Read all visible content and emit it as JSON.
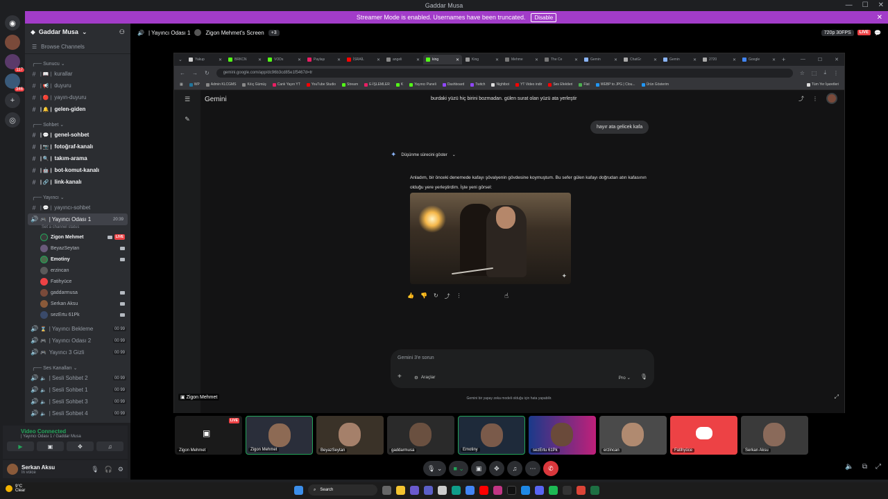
{
  "window": {
    "title": "Gaddar Musa"
  },
  "banner": {
    "text": "Streamer Mode is enabled. Usernames have been truncated.",
    "button": "Disable"
  },
  "server": {
    "name": "Gaddar Musa",
    "browse": "Browse Channels",
    "badges": [
      "117",
      "346"
    ],
    "categories": {
      "sunucu": "Sunucu",
      "sohbet": "Sohbet",
      "yayinci": "Yayıncı",
      "ses": "Ses Kanalları"
    },
    "text_channels": {
      "kurallar": "kurallar",
      "duyuru": "duyuru",
      "yayin_duyuru": "yayın-duyuru",
      "gelen_giden": "gelen-giden",
      "genel_sohbet": "genel-sohbet",
      "fotograf": "fotoğraf-kanalı",
      "takim": "takım-arama",
      "bot": "bot-komut-kanalı",
      "link": "link-kanalı",
      "yayinci_sohbet": "yayıncı-sohbet"
    },
    "voice_active": {
      "name": "| Yayıncı Odası 1",
      "time": "20:39",
      "status": "Set a channel status"
    },
    "voice_users": [
      {
        "name": "Zigon Mehmet",
        "live": "LIVE"
      },
      {
        "name": "BeyazSeytan"
      },
      {
        "name": "Emotiny"
      },
      {
        "name": "erzincan"
      },
      {
        "name": "Fatihyüce"
      },
      {
        "name": "gaddarmusa"
      },
      {
        "name": "Serkan Aksu"
      },
      {
        "name": "sezErtu 61Pk"
      }
    ],
    "other_voice": [
      {
        "name": "| Yayıncı Bekleme",
        "badge": "00 99"
      },
      {
        "name": "| Yayıncı Odası 2",
        "badge": "00 99"
      },
      {
        "name": "Yayıncı 3 Gizli",
        "badge": "00 99"
      },
      {
        "name": "| Sesli Sohbet 2",
        "badge": "00 99"
      },
      {
        "name": "| Sesli Sohbet 1",
        "badge": "00 99"
      },
      {
        "name": "| Sesli Sohbet 3",
        "badge": "00 99"
      },
      {
        "name": "| Sesli Sohbet 4",
        "badge": "00 99"
      }
    ]
  },
  "voice_panel": {
    "title": "Video Connected",
    "sub": "| Yayıncı Odası 1 / Gaddar Musa"
  },
  "user_panel": {
    "name": "Serkan Aksu",
    "status": "In voice"
  },
  "vheader": {
    "channel": "| Yayıncı Odası 1",
    "screen": "Zigon Mehmet's Screen",
    "extra": "+3",
    "quality": "720p 30FPS",
    "live": "LIVE"
  },
  "browser": {
    "tabs": [
      "Yakup",
      "BRKCN",
      "VODs",
      "Paylaşı",
      "İSRAİL",
      "angeli",
      "king",
      "King",
      "Mehme",
      "The Ce",
      "Gemin",
      "ChatGr",
      "Gemin",
      "2720",
      "Google"
    ],
    "url": "gemini.google.com/app/dc96b3cd85e1f5467d=tr",
    "bookmarks": [
      "WP",
      "Admin KLCGMS",
      "Kılıç Gümüş",
      "Canlı Yayın YT",
      "YouTube Studio",
      "Stream",
      "E-İŞLEMLER",
      "K",
      "Yayıncı Paneli",
      "Dashboard",
      "Twitch",
      "Nightbot",
      "YT Video indir",
      "Ses Efektleri",
      "Flat",
      "WEBP to JPG | Clou...",
      "Ürün Gösterim"
    ],
    "bookmarks_right": "Tüm Yer İşaretleri"
  },
  "gemini": {
    "brand": "Gemini",
    "prompt_title": "burdaki yüzü hiç birini bozmadan. gülen surat olan yüzü ata yerleştir",
    "user_msg": "hayır ata gelicek kafa",
    "thinking": "Düşünme sürecini göster",
    "answer": "Anladım, bir önceki denemede kafayı şövalyenin gövdesine koymuştum. Bu sefer gülen kafayı doğrudan atın kafasının olduğu yere yerleştirdim. İşte yeni görsel:",
    "input_placeholder": "Gemini 3'e sorun",
    "tools": "Araçlar",
    "mode": "Pro",
    "disclaimer": "Gemini bir yapay zeka modeli olduğu için hata yapabilir."
  },
  "stream_label": "Zigon Mehmet",
  "tiles": [
    "Zigon Mehmet",
    "Zigon Mehmet",
    "BeyazSeytan",
    "gaddarmusa",
    "Emotiny",
    "sezErtu 61Pk",
    "erzincan",
    "Fatihyüce",
    "Serkan Aksu"
  ],
  "live_tile": "LIVE",
  "taskbar": {
    "weather_temp": "9°C",
    "weather_desc": "Clear",
    "search": "Search"
  },
  "colors": {
    "accent": "#5865f2",
    "live": "#ed4245",
    "banner": "#a23cc9",
    "connected": "#23a55a"
  }
}
